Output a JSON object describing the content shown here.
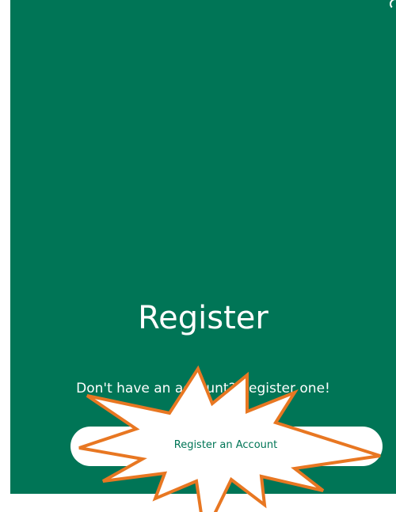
{
  "colors": {
    "panel": "#007556",
    "text_on_panel": "#ffffff",
    "button_bg": "#ffffff",
    "annotation_burst": "#e87722"
  },
  "panel": {
    "title": "Register",
    "subtitle": "Don't have an account? Register one!",
    "corner_icon": "refresh-icon"
  },
  "register_button": {
    "label": "Register an Account"
  },
  "annotation": {
    "shape": "starburst-highlight"
  }
}
